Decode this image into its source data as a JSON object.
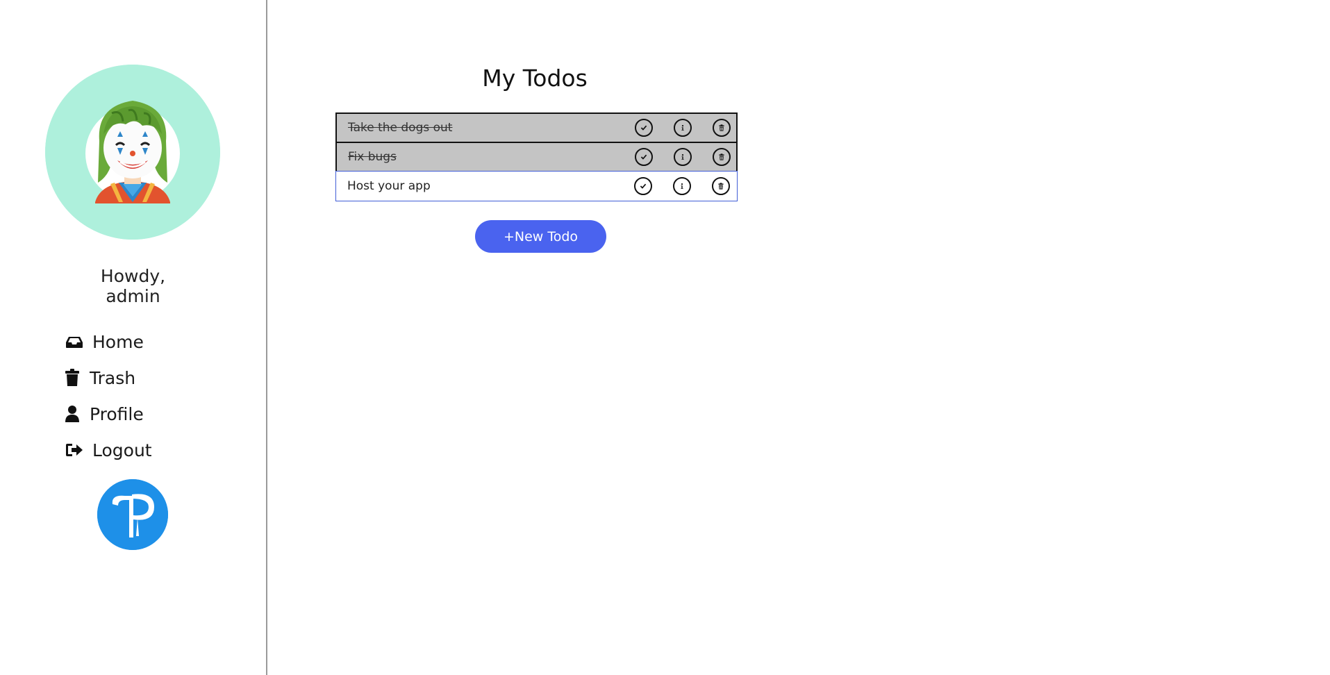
{
  "sidebar": {
    "greeting_line1": "Howdy,",
    "greeting_line2": "admin",
    "nav": [
      {
        "label": "Home",
        "icon": "inbox-icon"
      },
      {
        "label": "Trash",
        "icon": "trash-icon"
      },
      {
        "label": "Profile",
        "icon": "user-icon"
      },
      {
        "label": "Logout",
        "icon": "sign-out-icon"
      }
    ]
  },
  "main": {
    "title": "My Todos",
    "todos": [
      {
        "text": "Take the dogs out",
        "completed": true
      },
      {
        "text": "Fix bugs",
        "completed": true
      },
      {
        "text": "Host your app",
        "completed": false
      }
    ],
    "new_todo_label": "+New Todo"
  },
  "colors": {
    "avatar_bg": "#aef0dc",
    "accent": "#4a63ef",
    "completed_row_bg": "#c4c4c4",
    "active_row_border": "#3f5cd6",
    "brand_logo_bg": "#1e90e8"
  }
}
